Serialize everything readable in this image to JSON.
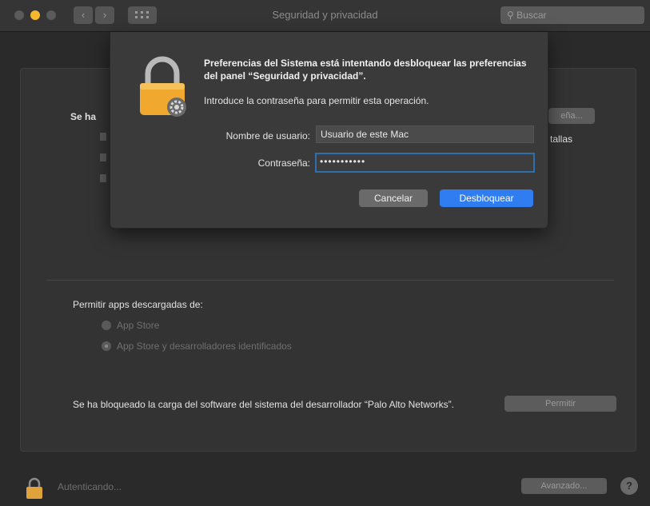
{
  "window": {
    "title": "Seguridad y privacidad",
    "search_placeholder": "Buscar"
  },
  "panel": {
    "partial_text": "Se ha",
    "password_button": "eña...",
    "partial_right": "tallas",
    "downloads_label": "Permitir apps descargadas de:",
    "option_app_store": "App Store",
    "option_identified": "App Store y desarrolladores identificados",
    "blocked_message": "Se ha bloqueado la carga del software del sistema del desarrollador “Palo Alto Networks”.",
    "allow_button": "Permitir"
  },
  "bottom": {
    "status": "Autenticando...",
    "advanced_button": "Avanzado...",
    "help": "?"
  },
  "dialog": {
    "title": "Preferencias del Sistema está intentando desbloquear las preferencias del panel “Seguridad y privacidad”.",
    "subtitle": "Introduce la contraseña para permitir esta operación.",
    "username_label": "Nombre de usuario:",
    "username_value": "Usuario de este Mac",
    "password_label": "Contraseña:",
    "password_value": "•••••••••••",
    "cancel_button": "Cancelar",
    "unlock_button": "Desbloquear"
  },
  "colors": {
    "accent": "#2f7df0",
    "lock": "#f0a92e"
  },
  "icons": [
    "lock-icon",
    "gear-badge-icon",
    "back-icon",
    "forward-icon",
    "grid-icon",
    "search-icon",
    "help-icon"
  ]
}
